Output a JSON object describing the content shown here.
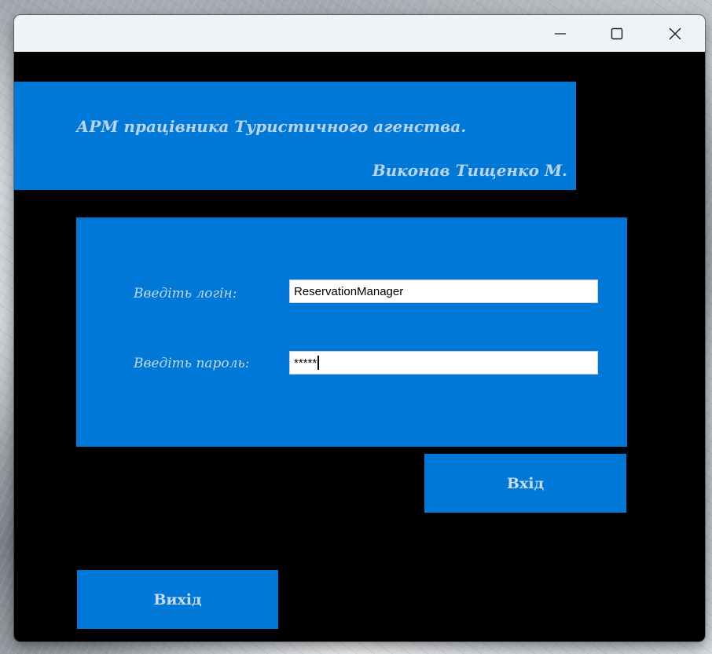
{
  "titlebar": {
    "minimize_icon": "minimize-icon",
    "maximize_icon": "maximize-icon",
    "close_icon": "close-icon"
  },
  "header": {
    "title": "АРМ працівника Туристичного агенства.",
    "author": "Виконав Тищенко М."
  },
  "form": {
    "login_label": "Введіть логін:",
    "login_value": "ReservationManager",
    "password_label": "Введіть пароль:",
    "password_value": "*****"
  },
  "buttons": {
    "enter_label": "Вхід",
    "exit_label": "Вихід"
  },
  "colors": {
    "panel_blue": "#0078d7",
    "window_background": "#000000",
    "titlebar": "#eff3f8",
    "label_text": "#c3d8ec"
  }
}
